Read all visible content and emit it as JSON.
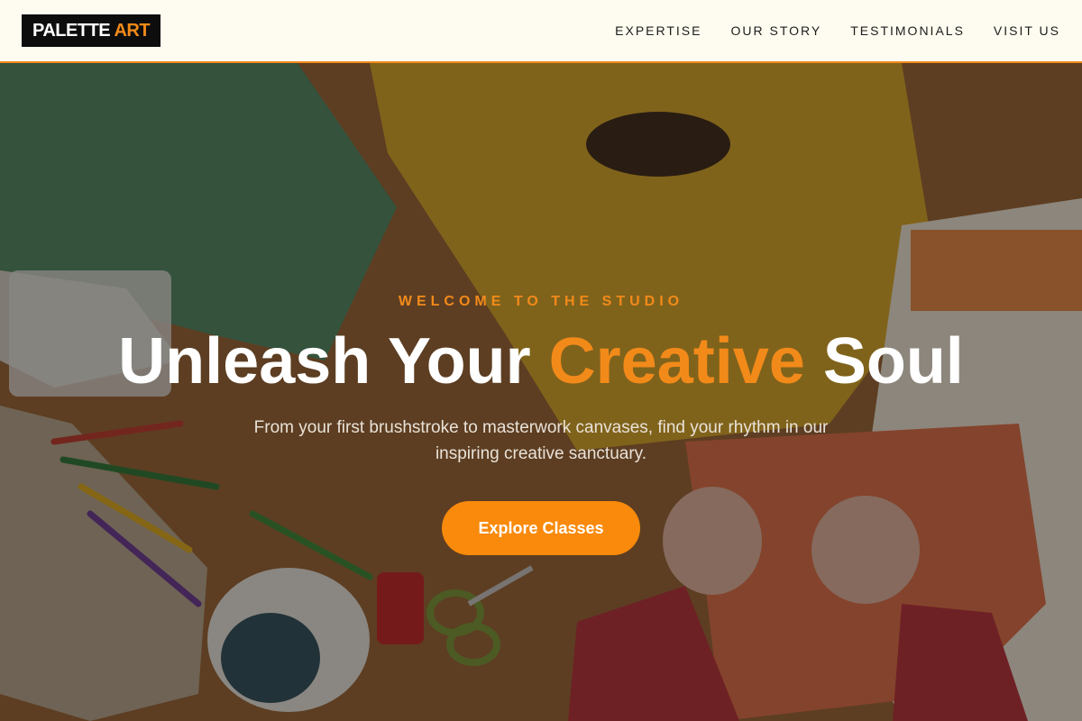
{
  "header": {
    "logo_main": "PALETTE",
    "logo_accent": "ART",
    "nav": [
      "EXPERTISE",
      "OUR STORY",
      "TESTIMONIALS",
      "VISIT US"
    ]
  },
  "hero": {
    "eyebrow": "WELCOME TO THE STUDIO",
    "headline_before": "Unleash Your ",
    "headline_accent": "Creative",
    "headline_after": " Soul",
    "subtitle": "From your first brushstroke to masterwork canvases, find your rhythm in our inspiring creative sanctuary.",
    "cta_label": "Explore Classes",
    "background_image": "craft-table-with-colored-paper-pencils-and-children-hands"
  },
  "colors": {
    "accent": "#f28a1a",
    "header_bg": "#fefcf0",
    "logo_bg": "#0d0d0d"
  }
}
